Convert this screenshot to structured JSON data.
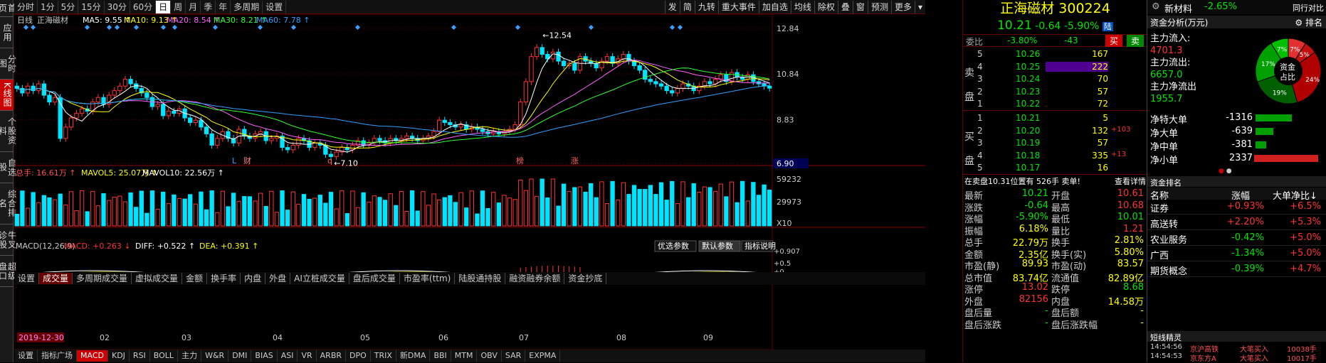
{
  "leftnav": [
    "首页",
    "应用",
    "分时图",
    "K线图",
    "个股资料",
    "自选股",
    "综合排名",
    "牛叉诊股",
    "超级盘口"
  ],
  "periods": [
    "分时",
    "1分",
    "5分",
    "15分",
    "30分",
    "60分",
    "日",
    "周",
    "月",
    "季",
    "年",
    "多周期",
    "设置"
  ],
  "tools": [
    "发",
    "简",
    "九转",
    "重大事件",
    "加自选",
    "均线",
    "除权",
    "叠",
    "窗",
    "预测",
    "更多"
  ],
  "kline": {
    "period_label": "日线",
    "name": "正海磁材",
    "ma5": "MA5: 9.55",
    "ma10": "MA10: 9.13",
    "ma20": "MA20: 8.54",
    "ma30": "MA30: 8.21",
    "ma60": "MA60: 7.78",
    "price_axis": [
      "12.84",
      "10.84",
      "8.83",
      "6.90"
    ],
    "high_label": "12.54",
    "low_label": "7.10",
    "markers": [
      "L",
      "财",
      "q",
      "榜",
      "涨"
    ]
  },
  "volume": {
    "total": "总手: 16.61万",
    "mavol5": "MAVOL5: 25.07万",
    "mavol10": "MAVOL10: 22.56万",
    "axis": [
      "59232",
      "29973",
      "X10"
    ]
  },
  "midtabs": [
    "设置",
    "成交量",
    "多周期成交量",
    "虚拟成交量",
    "金额",
    "换手率",
    "内盘",
    "外盘",
    "AI立桩成交量",
    "盘后成交量",
    "市盈率(ttm)",
    "陆股通持股",
    "融资融券余额",
    "资金抄底"
  ],
  "macd": {
    "label": "MACD(12,26,9)",
    "macd": "MACD: +0.263",
    "diff": "DIFF: +0.522",
    "dea": "DEA: +0.391",
    "buttons": [
      "优选参数",
      "默认参数",
      "指标说明"
    ],
    "axis": [
      "+0.907",
      "+0.5",
      "+0"
    ],
    "date": "2019-12-30",
    "months": [
      "02",
      "03",
      "04",
      "05",
      "06",
      "07",
      "08",
      "09"
    ]
  },
  "bottom_tabs": [
    "设置",
    "指标广场",
    "MACD",
    "KDJ",
    "RSI",
    "BOLL",
    "主力",
    "W&R",
    "DMI",
    "BIAS",
    "ASI",
    "VR",
    "ARBR",
    "DPO",
    "TRIX",
    "新DMA",
    "BBI",
    "MTM",
    "OBV",
    "SAR",
    "EXPMA"
  ],
  "quote": {
    "name": "正海磁材",
    "code": "300224",
    "price": "10.21",
    "change": "-0.64",
    "pct": "-5.90%",
    "tag": "陆",
    "weibi_label": "委比",
    "weibi": "-3.80%",
    "weicha": "-43",
    "buy_btn": "买",
    "sell_btn": "卖",
    "sells": [
      [
        "5",
        "10.26",
        "167",
        ""
      ],
      [
        "4",
        "10.25",
        "222",
        ""
      ],
      [
        "3",
        "10.24",
        "70",
        ""
      ],
      [
        "2",
        "10.23",
        "57",
        ""
      ],
      [
        "1",
        "10.22",
        "72",
        ""
      ]
    ],
    "buys": [
      [
        "1",
        "10.21",
        "5",
        ""
      ],
      [
        "2",
        "10.20",
        "132",
        "+103"
      ],
      [
        "3",
        "10.19",
        "57",
        ""
      ],
      [
        "4",
        "10.18",
        "335",
        "+13"
      ],
      [
        "5",
        "10.17",
        "16",
        ""
      ]
    ],
    "sell_side": "卖盘",
    "buy_side": "买盘",
    "notice": "在卖盘10.31位置有 526手 卖单!",
    "notice_link": "查看详情",
    "stats": [
      [
        "最新",
        "10.21",
        "开盘",
        "10.61"
      ],
      [
        "涨跌",
        "-0.64",
        "最高",
        "10.68"
      ],
      [
        "涨幅",
        "-5.90%",
        "最低",
        "10.01"
      ],
      [
        "振幅",
        "6.18%",
        "量比",
        "1.21"
      ],
      [
        "总手",
        "22.79万",
        "换手",
        "2.81%"
      ],
      [
        "金额",
        "2.35亿",
        "换手(实)",
        "5.80%"
      ],
      [
        "市盈(静)",
        "89.93",
        "市盈(动)",
        "83.57"
      ],
      [
        "总市值",
        "83.74亿",
        "流通值",
        "82.89亿"
      ],
      [
        "涨停",
        "13.02",
        "跌停",
        "8.68"
      ],
      [
        "外盘",
        "82156",
        "内盘",
        "14.58万"
      ],
      [
        "盘后量",
        "-",
        "盘后额",
        "-"
      ],
      [
        "盘后涨跌",
        "-",
        "盘后涨跌幅",
        "-"
      ]
    ]
  },
  "side": {
    "title": "新材料",
    "pct": "-2.65%",
    "link": "同行对比",
    "fund_title": "资金分析(万元)",
    "fund_rank": "排名",
    "inflow_label": "主力流入:",
    "inflow": "4701.3",
    "outflow_label": "主力流出:",
    "outflow": "6657.0",
    "net_label": "主力净流出",
    "net": "1955.7",
    "pie_center": "资金占比",
    "pie": [
      [
        "7%",
        "#e03030"
      ],
      [
        "5%",
        "#c01010"
      ],
      [
        "24%",
        "#b00000"
      ],
      [
        "19%",
        "#006000"
      ],
      [
        "17%",
        "#00a000"
      ],
      [
        "7%",
        "#00c000"
      ]
    ],
    "flows": [
      [
        "净特大单",
        "-1316"
      ],
      [
        "净大单",
        "-639"
      ],
      [
        "净中单",
        "-381"
      ],
      [
        "净小单",
        "2337"
      ]
    ],
    "rank_title": "资金排名",
    "rank_headers": [
      "名称",
      "涨幅",
      "大单净比"
    ],
    "ranks": [
      [
        "证券",
        "+0.93%",
        "+6.5%"
      ],
      [
        "高送转",
        "+2.20%",
        "+5.3%"
      ],
      [
        "农业服务",
        "-0.42%",
        "+5.0%"
      ],
      [
        "广西",
        "-1.34%",
        "+5.0%"
      ],
      [
        "期货概念",
        "-0.39%",
        "+4.7%"
      ]
    ],
    "sprite_title": "短线精灵",
    "sprites": [
      [
        "14:54:56",
        "京沪高铁",
        "大笔买入",
        "10038手"
      ],
      [
        "14:54:53",
        "京东方A",
        "大笔买入",
        "10017手"
      ]
    ]
  },
  "chart_data": {
    "type": "candlestick",
    "title": "正海磁材 日线",
    "ylim": [
      6.9,
      12.84
    ],
    "high": 12.54,
    "low": 7.1,
    "closes": [
      10.2,
      10.0,
      10.3,
      10.1,
      10.4,
      9.9,
      9.6,
      9.8,
      8.0,
      8.5,
      8.9,
      9.1,
      9.3,
      9.2,
      9.6,
      9.8,
      9.5,
      9.9,
      10.1,
      10.3,
      10.6,
      10.4,
      10.2,
      10.0,
      9.8,
      9.4,
      9.5,
      9.0,
      9.2,
      9.1,
      9.3,
      8.9,
      8.7,
      8.8,
      8.5,
      8.2,
      7.7,
      8.0,
      8.3,
      8.0,
      7.8,
      8.4,
      8.1,
      8.0,
      8.2,
      8.3,
      7.9,
      8.0,
      8.1,
      7.6,
      7.5,
      7.7,
      8.0,
      7.9,
      7.6,
      7.8,
      7.7,
      7.3,
      7.2,
      7.4,
      7.6,
      7.5,
      7.7,
      7.9,
      7.7,
      7.8,
      8.0,
      7.9,
      7.8,
      8.0,
      7.9,
      8.0,
      8.1,
      8.0,
      7.9,
      8.0,
      8.1,
      8.3,
      8.8,
      8.7,
      8.6,
      8.5,
      8.6,
      8.4,
      8.5,
      8.4,
      8.3,
      8.2,
      8.3,
      8.2,
      8.3,
      8.4,
      8.6,
      9.6,
      10.5,
      11.6,
      12.0,
      11.7,
      11.5,
      11.8,
      11.4,
      11.2,
      11.3,
      11.0,
      11.6,
      11.4,
      11.3,
      11.1,
      11.4,
      11.6,
      11.3,
      11.5,
      11.7,
      11.4,
      11.2,
      11.0,
      10.6,
      10.5,
      10.4,
      10.3,
      10.1,
      10.0,
      10.2,
      10.4,
      10.3,
      10.1,
      10.3,
      10.5,
      10.4,
      10.6,
      10.8,
      10.5,
      10.9,
      10.7,
      10.6,
      10.8,
      10.5,
      10.4,
      10.3,
      10.21
    ]
  }
}
